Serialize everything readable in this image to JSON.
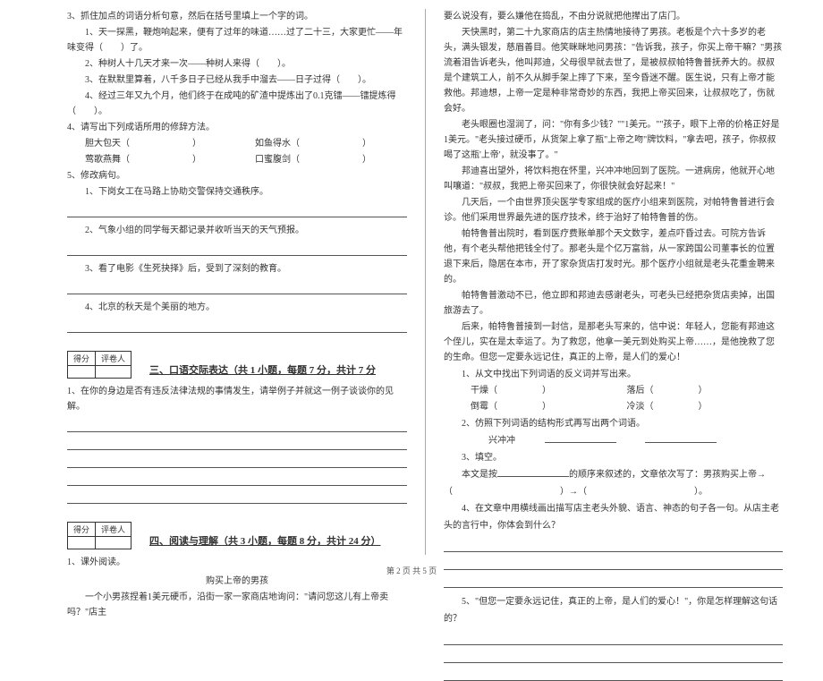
{
  "left": {
    "q3": "3、抓住加点的词语分析句意，然后在括号里填上一个字的词。",
    "q3_1": "1、天一探黑，鞭炮响起来，便有了过年的味道……过了二十三，大家更忙——年味变得（　　）了。",
    "q3_2": "2、种树人十几天才来一次——种树人来得（　　）。",
    "q3_3": "3、在默默里算着，八千多日子已经从我手中溜去——日子过得（　　）。",
    "q3_4": "4、经过三年又九个月，他们终于在成吨的矿渣中提炼出了0.1克镭——镭提炼得（　　）。",
    "q4": "4、请写出下列成语所用的修辞方法。",
    "q4_1a": "胆大包天（　　　　　　　）",
    "q4_1b": "如鱼得水（　　　　　　　）",
    "q4_2a": "莺歌燕舞（　　　　　　　）",
    "q4_2b": "口蜜腹剑（　　　　　　　）",
    "q5": "5、修改病句。",
    "q5_1": "1、下岗女工在马路上协助交警保持交通秩序。",
    "q5_2": "2、气象小组的同学每天都记录并收听当天的天气预报。",
    "q5_3": "3、看了电影《生死抉择》后，受到了深刻的教育。",
    "q5_4": "4、北京的秋天是个美丽的地方。",
    "section3_title": "三、口语交际表达（共 1 小题，每题 7 分，共计 7 分",
    "s3_q1": "1、在你的身边是否有违反法律法规的事情发生，请举例子并就这一例子谈谈你的见解。",
    "section4_title": "四、阅读与理解（共 3 小题，每题 8 分，共计 24 分）",
    "s4_q1": "1、课外阅读。",
    "s4_title": "购买上帝的男孩",
    "s4_p1": "一个小男孩捏着1美元硬币，沿街一家一家商店地询问：\"请问您这儿有上帝卖吗？\"店主",
    "score_head1": "得分",
    "score_head2": "评卷人"
  },
  "right": {
    "p1": "要么说没有，要么嫌他在捣乱，不由分说就把他撵出了店门。",
    "p2": "天快黑时，第二十九家商店的店主热情地接待了男孩。老板是个六十多岁的老头，满头银发，慈眉善目。他笑眯眯地问男孩：\"告诉我，孩子，你买上帝干嘛？\"男孩流着泪告诉老头，他叫邦迪，父母很早就去世了，是被叔叔帕特鲁普抚养大的。叔叔是个建筑工人，前不久从脚手架上摔了下来，至今昏迷不醒。医生说，只有上帝才能救他。邦迪想，上帝一定是种非常奇妙的东西，我把上帝买回来，让叔叔吃了，伤就会好。",
    "p3": "老头眼圈也湿润了，问：\"你有多少钱？\"\"1美元。\"\"孩子，眼下上帝的价格正好是1美元。\"老头接过硬币，从货架上拿了瓶\"上帝之吻\"牌饮料，\"拿去吧，孩子，你叔叔喝了这瓶'上帝'，就没事了。\"",
    "p4": "邦迪喜出望外，将饮料抱在怀里，兴冲冲地回到了医院。一进病房，他就开心地叫嚷道：\"叔叔，我把上帝买回来了，你很快就会好起来！\"",
    "p5": "几天后，一个由世界顶尖医学专家组成的医疗小组来到医院，对帕特鲁普进行会诊。他们采用世界最先进的医疗技术，终于治好了帕特鲁普的伤。",
    "p6": "帕特鲁普出院时，看到医疗费账单那个天文数字，差点吓昏过去。可院方告诉他，有个老头帮他把钱全付了。那老头是个亿万富翁，从一家跨国公司董事长的位置退下来后，隐居在本市，开了家杂货店打发时光。那个医疗小组就是老头花重金聘来的。",
    "p7": "帕特鲁普激动不已，他立即和邦迪去感谢老头，可老头已经把杂货店卖掉，出国旅游去了。",
    "p8": "后来，帕特鲁普接到一封信，是那老头写来的，信中说：年轻人，您能有邦迪这个侄儿，实在是太幸运了。为了救您，他拿一美元到处购买上帝……，是他挽救了您的生命。但您一定要永远记住，真正的上帝，是人们的爱心！",
    "q1": "1、从文中找出下列词语的反义词并写出来。",
    "q1_a": "干燥（　　　　　）",
    "q1_b": "落后（　　　　　）",
    "q1_c": "倒霉（　　　　　）",
    "q1_d": "冷淡（　　　　　）",
    "q2": "2、仿照下列词语的结构形式再写出两个词语。",
    "q2_ex": "兴冲冲",
    "q3": "3、填空。",
    "q3_text_a": "本文是按",
    "q3_text_b": "的顺序来叙述的，文章依次写了：男孩购买上帝→",
    "q3_blank_c": "（　　　　　　　　　　　　）→（　　　　　　　　　　　　）。",
    "q4": "4、在文章中用横线画出描写店主老头外貌、语言、神态的句子各一句。从店主老头的言行中，你体会到什么？",
    "q5": "5、\"但您一定要永远记住，真正的上帝，是人们的爱心！\"，你是怎样理解这句话的？"
  },
  "footer": "第 2 页  共 5 页"
}
